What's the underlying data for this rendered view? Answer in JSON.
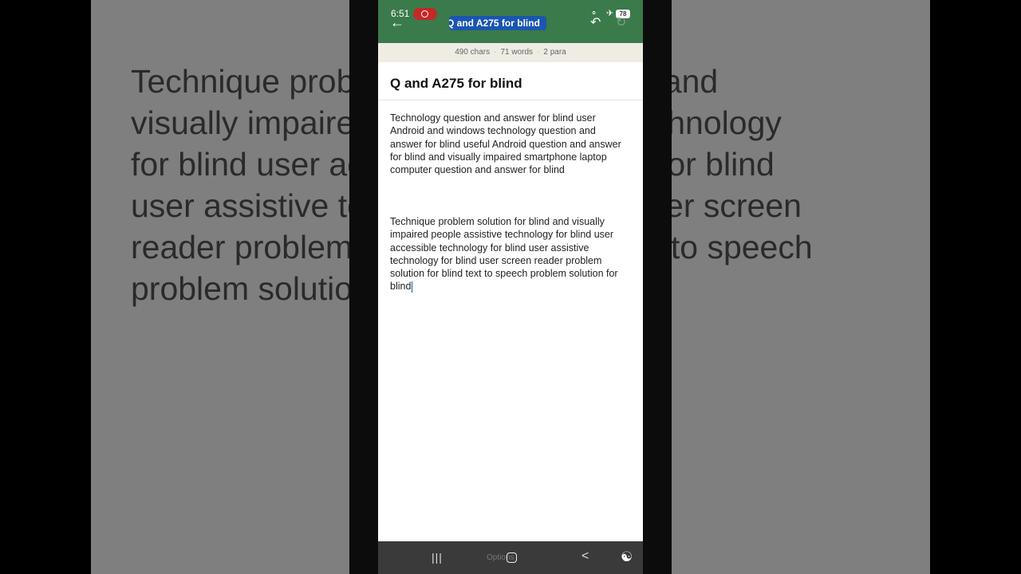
{
  "background": {
    "lines": [
      "Technique problem solution for blind and",
      "visually impaired people assistive technology",
      "for blind user accessible technology for blind",
      "user assistive technology for blind user screen",
      "reader problem solution for blind text to speech",
      "problem solution for blind"
    ]
  },
  "status_bar": {
    "time": "6:51",
    "battery": "78"
  },
  "toolbar": {
    "title": "Q and A275 for blind",
    "back_icon": "arrow-left-icon",
    "undo_icon": "undo-icon",
    "redo_icon": "redo-icon"
  },
  "stats": {
    "chars": "490 chars",
    "words": "71 words",
    "paras": "2 para"
  },
  "document": {
    "title": "Q and A275 for blind",
    "paragraph1": "Technology question and answer for blind user Android and windows technology question and answer for blind useful Android question and answer for blind and visually impaired smartphone laptop computer question and answer for blind",
    "paragraph2": "Technique problem solution for blind and visually impaired people assistive technology for blind user accessible technology for blind user assistive technology for blind user screen reader problem solution for blind text to speech problem solution for blind"
  },
  "navbar": {
    "recents": "|||",
    "options": "Options",
    "back": "<",
    "accessibility_icon": "accessibility-icon"
  },
  "colors": {
    "appbar": "#3b7a4a",
    "title_highlight": "#1a56b0",
    "stats_bg": "#efece4",
    "navbar": "#3a3a3a"
  }
}
